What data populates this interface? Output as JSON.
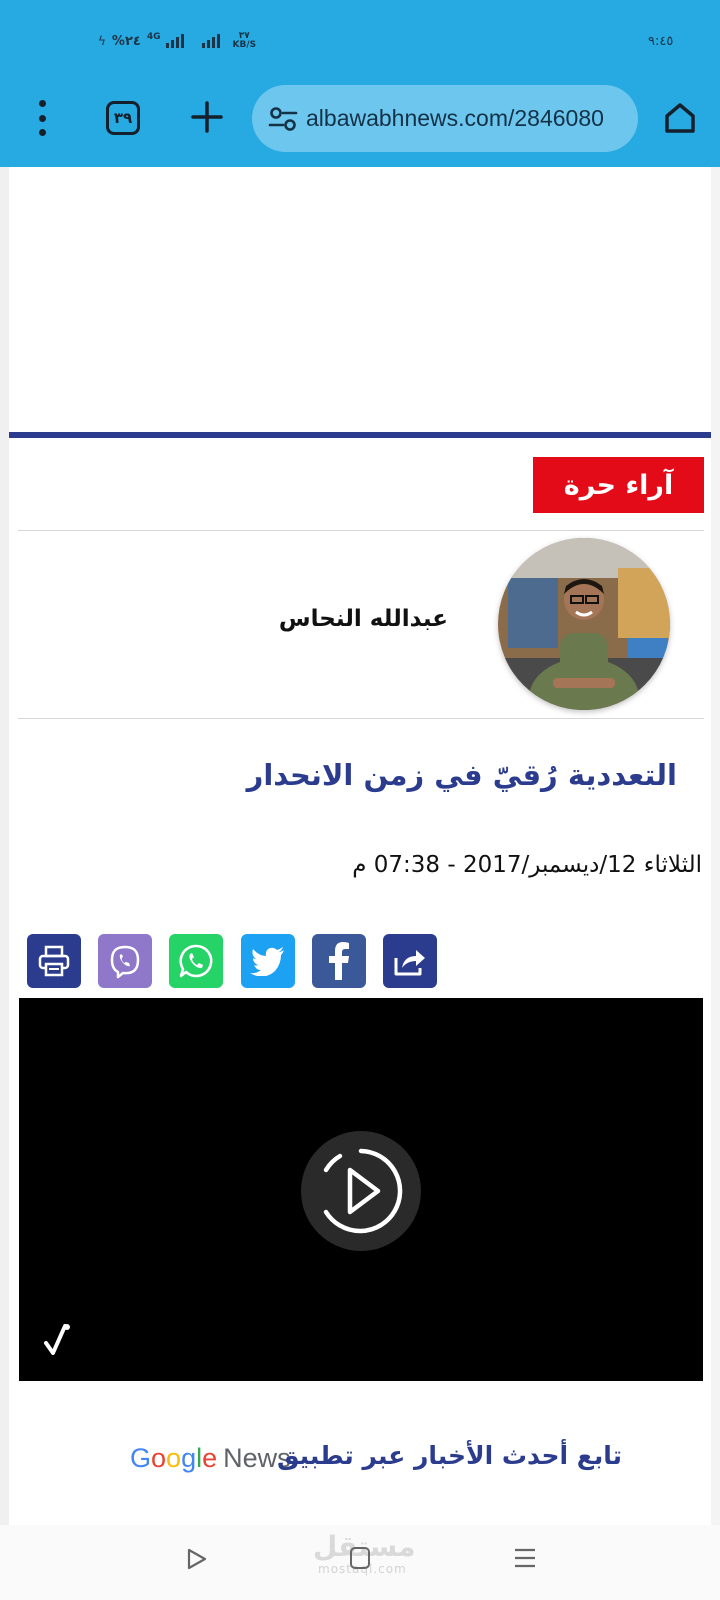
{
  "status_bar": {
    "time": "٩:٤٥",
    "speed_value": "٣٧",
    "speed_unit": "KB/S",
    "network": "4G",
    "battery": "%٢٤"
  },
  "browser": {
    "url": "albawabhnews.com/2846080",
    "tab_count": "٣٩",
    "home_icon": "home-icon",
    "new_tab_icon": "plus-icon",
    "menu_icon": "more-vert-icon",
    "site_info_icon": "tune-icon"
  },
  "article": {
    "section": "آراء حرة",
    "author": "عبدالله النحاس",
    "title": "التعددية رُقيّ في زمن الانحدار",
    "date": "الثلاثاء 12/ديسمبر/2017 - 07:38 م",
    "share_buttons": [
      {
        "name": "share",
        "color": "#2b3c8e"
      },
      {
        "name": "facebook",
        "color": "#3b5998"
      },
      {
        "name": "twitter",
        "color": "#1da1f2"
      },
      {
        "name": "whatsapp",
        "color": "#25d366"
      },
      {
        "name": "viber",
        "color": "#8f78c9"
      },
      {
        "name": "print",
        "color": "#2b3c8e"
      }
    ]
  },
  "promo": {
    "follow_text": "تابع أحدث الأخبار عبر تطبيق",
    "google_letters": [
      "G",
      "o",
      "o",
      "g",
      "l",
      "e"
    ],
    "news_word": "News"
  },
  "watermark": {
    "text": "مستقل",
    "sub": "mostaql.com"
  },
  "colors": {
    "browser_bar": "#27a9e1",
    "brand_blue": "#2b3c8e",
    "section_red": "#e30b17"
  }
}
